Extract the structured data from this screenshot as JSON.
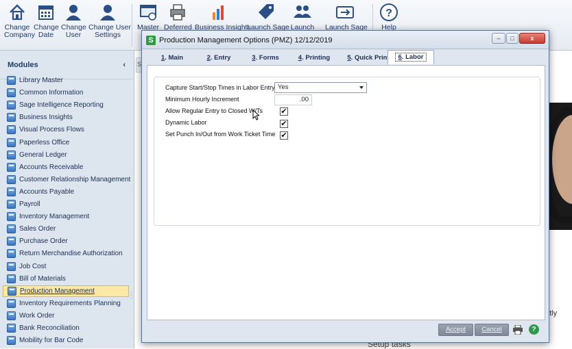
{
  "ribbon": {
    "buttons": [
      {
        "line1": "Change",
        "line2": "Company",
        "icon": "home-icon"
      },
      {
        "line1": "Change",
        "line2": "Date",
        "icon": "calendar-icon"
      },
      {
        "line1": "Change",
        "line2": "User",
        "icon": "user-icon"
      },
      {
        "line1": "Change User",
        "line2": "Settings",
        "icon": "user-settings-icon"
      },
      {
        "line1": "Master",
        "line2": "",
        "icon": "master-console-icon"
      },
      {
        "line1": "Deferred",
        "line2": "",
        "icon": "printer-icon"
      },
      {
        "line1": "Business Insights",
        "line2": "",
        "icon": "bar-chart-icon"
      },
      {
        "line1": "Launch Sage",
        "line2": "",
        "icon": "tag-icon"
      },
      {
        "line1": "Launch",
        "line2": "",
        "icon": "people-icon"
      },
      {
        "line1": "Launch Sage",
        "line2": "",
        "icon": "card-icon"
      },
      {
        "line1": "Help",
        "line2": "",
        "icon": "help-icon"
      }
    ]
  },
  "sidebar": {
    "title": "Modules",
    "collapse_glyph": "‹",
    "items": [
      "Library Master",
      "Common Information",
      "Sage Intelligence Reporting",
      "Business Insights",
      "Visual Process Flows",
      "Paperless Office",
      "General Ledger",
      "Accounts Receivable",
      "Customer Relationship Management",
      "Accounts Payable",
      "Payroll",
      "Inventory Management",
      "Sales Order",
      "Purchase Order",
      "Return Merchandise Authorization",
      "Job Cost",
      "Bill of Materials",
      "Production Management",
      "Inventory Requirements Planning",
      "Work Order",
      "Bank Reconciliation",
      "Mobility for Bar Code"
    ],
    "selected": "Production Management"
  },
  "background": {
    "tab_letter": "S",
    "text_right": "ntly",
    "text_bottom": "Setup tasks"
  },
  "dialog": {
    "title": "Production Management Options (PMZ) 12/12/2019",
    "app_icon_letter": "S",
    "minimize": "–",
    "maximize": "□",
    "close": "x",
    "tabs": [
      {
        "key": "1",
        "label": "Main"
      },
      {
        "key": "2",
        "label": "Entry"
      },
      {
        "key": "3",
        "label": "Forms"
      },
      {
        "key": "4",
        "label": "Printing"
      },
      {
        "key": "5",
        "label": "Quick Print"
      },
      {
        "key": "6",
        "label": "Labor"
      }
    ],
    "active_tab": "6. Labor",
    "fields": {
      "capture_label": "Capture Start/Stop Times in Labor Entry",
      "capture_value": "Yes",
      "min_hourly_label": "Minimum Hourly Increment",
      "min_hourly_value": ".00",
      "allow_regular_label": "Allow Regular Entry to Closed W/Ts",
      "allow_regular_checked": true,
      "dynamic_labor_label": "Dynamic Labor",
      "dynamic_labor_checked": true,
      "punch_label": "Set Punch In/Out from Work Ticket Time",
      "punch_checked": true,
      "check_glyph": "✔"
    },
    "footer": {
      "accept_label": "Accept",
      "cancel_label": "Cancel",
      "help_glyph": "?"
    }
  }
}
